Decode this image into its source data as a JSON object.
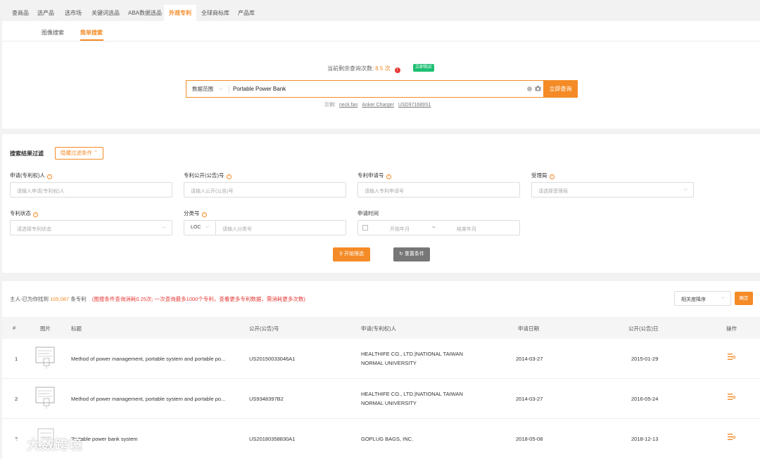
{
  "top_tabs": [
    "查商品",
    "选产品",
    "选市场",
    "关键词选品",
    "ABA数据选品",
    "外观专利",
    "全球商标库",
    "产品库"
  ],
  "sub_tabs": [
    "图像搜索",
    "简单搜索"
  ],
  "quota": {
    "label": "当前剩余查询次数:",
    "value": "8.5 次",
    "buy": "立即购买"
  },
  "search": {
    "scope": "数据范围",
    "value": "Portable Power Bank",
    "button": "立即查询",
    "examples_label": "示例:",
    "examples": [
      "neck fan",
      "Anker Charger",
      "USD971689S1"
    ]
  },
  "filters": {
    "title": "搜索结果过滤",
    "hide_button": "隐藏过滤条件",
    "applicant": {
      "label": "申请(专利权)人",
      "placeholder": "请输入申请(专利权)人"
    },
    "pub_no": {
      "label": "专利公开(公告)号",
      "placeholder": "请输入公开(公告)号"
    },
    "app_no": {
      "label": "专利申请号",
      "placeholder": "请输入专利申请号"
    },
    "office": {
      "label": "受理局",
      "placeholder": "请选择受理局"
    },
    "status": {
      "label": "专利状态",
      "placeholder": "请选择专利状态"
    },
    "class_no": {
      "label": "分类号",
      "prefix": "LOC",
      "placeholder": "请输入分类号"
    },
    "app_time": {
      "label": "申请时间",
      "start": "开始年月",
      "sep": "~",
      "end": "结束年月"
    },
    "start_button": "开始筛选",
    "reset_button": "重置条件"
  },
  "results": {
    "prefix": "主人-已为你找到",
    "count": "105,087",
    "suffix": "条专利",
    "note": "(图搜条件查询消耗0.25次; 一次查询最多1000个专利，查看更多专利数据，需消耗更多次数)",
    "sort": "相关度降序",
    "confirm": "确定",
    "columns": [
      "#",
      "图片",
      "标题",
      "公开(公告)号",
      "申请(专利权)人",
      "申请日期",
      "公开(公告)日",
      "操作"
    ],
    "rows": [
      {
        "idx": "1",
        "title": "Method of power management, portable system and portable po...",
        "pub_no": "US20150033046A1",
        "applicant_l1": "HEALTHIFE CO., LTD.|NATIONAL TAIWAN",
        "applicant_l2": "NORMAL UNIVERSITY",
        "app_date": "2014-03-27",
        "pub_date": "2015-01-29"
      },
      {
        "idx": "2",
        "title": "Method of power management, portable system and portable po...",
        "pub_no": "US9348397B2",
        "applicant_l1": "HEALTHIFE CO., LTD.|NATIONAL TAIWAN",
        "applicant_l2": "NORMAL UNIVERSITY",
        "app_date": "2014-03-27",
        "pub_date": "2016-05-24"
      },
      {
        "idx": "3",
        "title": "Portable power bank system",
        "pub_no": "US20180358830A1",
        "applicant_l1": "GOPLUG BAGS, INC.",
        "applicant_l2": "",
        "app_date": "2018-05-08",
        "pub_date": "2018-12-13"
      }
    ]
  },
  "watermark": "大数跨境",
  "colors": {
    "accent": "#f48b26",
    "green": "#1dbf73",
    "red": "#e53935"
  }
}
